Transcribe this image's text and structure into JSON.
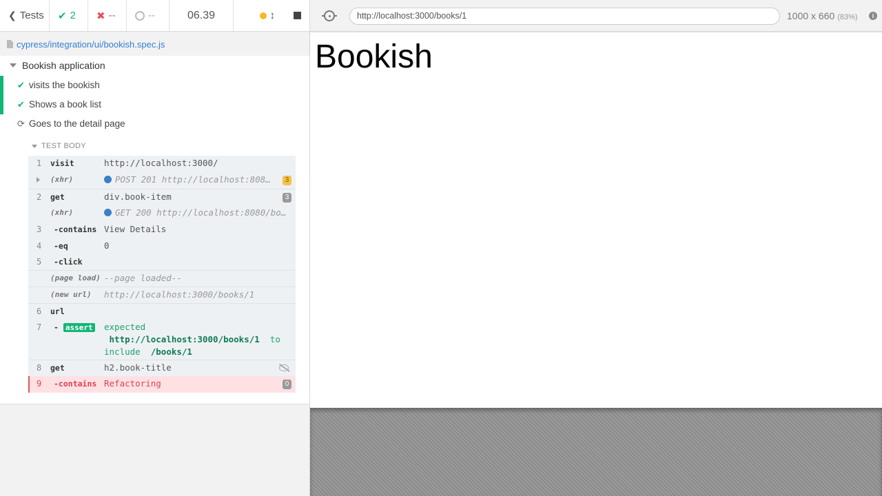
{
  "header": {
    "tests_label": "Tests",
    "passed_count": "2",
    "failed_count": "--",
    "pending_count": "--",
    "timer": "06.39"
  },
  "spec": {
    "path": "cypress/integration/ui/bookish.spec.js"
  },
  "suite": {
    "title": "Bookish application",
    "tests": [
      {
        "label": "visits the bookish",
        "status": "passed"
      },
      {
        "label": "Shows a book list",
        "status": "passed"
      },
      {
        "label": "Goes to the detail page",
        "status": "running"
      }
    ],
    "body_label": "TEST BODY"
  },
  "commands": [
    {
      "num": "1",
      "name": "visit",
      "msg": "http://localhost:3000/"
    },
    {
      "num": "",
      "name": "(xhr)",
      "msg": "POST 201 http://localhost:8080/books",
      "badge": "3"
    },
    {
      "num": "2",
      "name": "get",
      "msg": "div.book-item",
      "badge": "3"
    },
    {
      "num": "",
      "name": "(xhr)",
      "msg": "GET 200 http://localhost:8080/books"
    },
    {
      "num": "3",
      "name": "-contains",
      "msg": "View Details"
    },
    {
      "num": "4",
      "name": "-eq",
      "msg": "0"
    },
    {
      "num": "5",
      "name": "-click",
      "msg": ""
    },
    {
      "num": "",
      "name": "(page load)",
      "msg": "--page loaded--"
    },
    {
      "num": "",
      "name": "(new url)",
      "msg": "http://localhost:3000/books/1"
    },
    {
      "num": "6",
      "name": "url",
      "msg": ""
    },
    {
      "num": "7",
      "name": "assert",
      "msg_expected": "expected",
      "msg_url": "http://localhost:3000/books/1",
      "msg_to": "to",
      "msg_include": "include",
      "msg_path": "/books/1"
    },
    {
      "num": "8",
      "name": "get",
      "msg": "h2.book-title"
    },
    {
      "num": "9",
      "name": "-contains",
      "msg": "Refactoring",
      "badge": "0"
    }
  ],
  "aut": {
    "url": "http://localhost:3000/books/1",
    "viewport": "1000 x 660",
    "scale": "(83%)",
    "page_heading": "Bookish"
  },
  "colors": {
    "pass": "#13b676",
    "fail": "#e94f5f",
    "link": "#3380d0"
  }
}
